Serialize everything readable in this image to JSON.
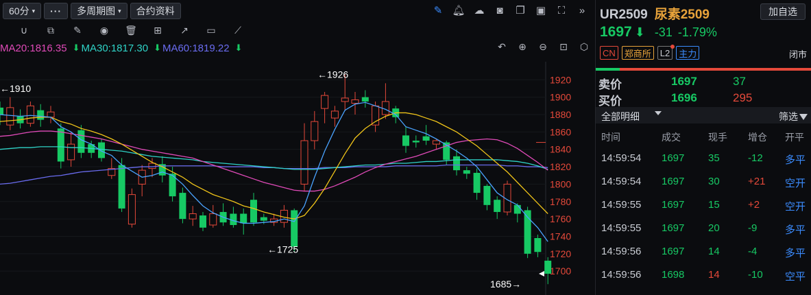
{
  "toolbar": {
    "period": "60分",
    "more": "···",
    "multi_period": "多周期图",
    "contract_info": "合约资料"
  },
  "ma": [
    {
      "label": "MA20:1816.35",
      "color": "#e04ab8",
      "arrow": ""
    },
    {
      "label": "MA30:1817.30",
      "color": "#2fd3c7",
      "arrow": "⬇"
    },
    {
      "label": "MA60:1819.22",
      "color": "#6a6cf0",
      "arrow": "⬇"
    }
  ],
  "ma_trailing_arrow": "⬇",
  "colors": {
    "up": "#e5493a",
    "down": "#17c964",
    "ma5": "#4aa3ff",
    "ma10": "#f0c419",
    "ma20": "#e04ab8",
    "ma30": "#2fd3c7",
    "ma60": "#6a6cf0",
    "accent": "#3b8cff"
  },
  "chart_data": {
    "type": "candlestick",
    "y_ticks": [
      1920,
      1900,
      1880,
      1860,
      1840,
      1820,
      1800,
      1780,
      1760,
      1740,
      1720,
      1700
    ],
    "ylim": [
      1682,
      1936
    ],
    "annotations": [
      {
        "text": "←1910",
        "value": 1910
      },
      {
        "text": "←1926",
        "value": 1926
      },
      {
        "text": "←1725",
        "value": 1725
      },
      {
        "text": "1685→",
        "value": 1685
      }
    ],
    "current_marker": 1697,
    "candles": [
      [
        1888,
        1880,
        1895,
        1868
      ],
      [
        1868,
        1888,
        1900,
        1862
      ],
      [
        1878,
        1870,
        1886,
        1864
      ],
      [
        1870,
        1890,
        1895,
        1866
      ],
      [
        1885,
        1874,
        1892,
        1866
      ],
      [
        1877,
        1883,
        1890,
        1870
      ],
      [
        1864,
        1826,
        1870,
        1818
      ],
      [
        1828,
        1846,
        1860,
        1820
      ],
      [
        1862,
        1836,
        1868,
        1830
      ],
      [
        1846,
        1836,
        1850,
        1830
      ],
      [
        1848,
        1830,
        1852,
        1826
      ],
      [
        1810,
        1818,
        1830,
        1806
      ],
      [
        1822,
        1772,
        1830,
        1768
      ],
      [
        1754,
        1788,
        1795,
        1750
      ],
      [
        1800,
        1816,
        1822,
        1786
      ],
      [
        1818,
        1824,
        1830,
        1808
      ],
      [
        1823,
        1810,
        1832,
        1802
      ],
      [
        1812,
        1786,
        1820,
        1780
      ],
      [
        1790,
        1760,
        1796,
        1755
      ],
      [
        1760,
        1766,
        1775,
        1752
      ],
      [
        1764,
        1750,
        1768,
        1746
      ],
      [
        1753,
        1766,
        1776,
        1750
      ],
      [
        1768,
        1756,
        1778,
        1752
      ],
      [
        1766,
        1753,
        1774,
        1750
      ],
      [
        1766,
        1755,
        1772,
        1742
      ],
      [
        1782,
        1756,
        1790,
        1752
      ],
      [
        1762,
        1758,
        1766,
        1754
      ],
      [
        1756,
        1760,
        1766,
        1752
      ],
      [
        1756,
        1770,
        1776,
        1750
      ],
      [
        1770,
        1728,
        1772,
        1722
      ],
      [
        1800,
        1850,
        1870,
        1792
      ],
      [
        1850,
        1872,
        1884,
        1840
      ],
      [
        1887,
        1902,
        1906,
        1870
      ],
      [
        1876,
        1884,
        1890,
        1866
      ],
      [
        1895,
        1899,
        1926,
        1884
      ],
      [
        1893,
        1897,
        1906,
        1880
      ],
      [
        1900,
        1895,
        1908,
        1888
      ],
      [
        1868,
        1890,
        1895,
        1860
      ],
      [
        1880,
        1895,
        1916,
        1875
      ],
      [
        1887,
        1877,
        1890,
        1870
      ],
      [
        1856,
        1844,
        1866,
        1836
      ],
      [
        1850,
        1848,
        1856,
        1842
      ],
      [
        1855,
        1850,
        1868,
        1845
      ],
      [
        1846,
        1850,
        1852,
        1840
      ],
      [
        1848,
        1828,
        1850,
        1822
      ],
      [
        1832,
        1816,
        1840,
        1810
      ],
      [
        1816,
        1812,
        1820,
        1806
      ],
      [
        1813,
        1790,
        1818,
        1782
      ],
      [
        1798,
        1776,
        1800,
        1770
      ],
      [
        1782,
        1768,
        1786,
        1760
      ],
      [
        1768,
        1800,
        1804,
        1764
      ],
      [
        1776,
        1766,
        1778,
        1756
      ],
      [
        1770,
        1720,
        1774,
        1715
      ],
      [
        1738,
        1722,
        1742,
        1716
      ],
      [
        1712,
        1697,
        1716,
        1685
      ]
    ],
    "ma5": [
      1880,
      1879,
      1878,
      1879,
      1878,
      1877,
      1866,
      1860,
      1851,
      1846,
      1838,
      1833,
      1822,
      1815,
      1808,
      1810,
      1814,
      1810,
      1800,
      1787,
      1775,
      1767,
      1762,
      1758,
      1755,
      1755,
      1756,
      1757,
      1760,
      1757,
      1775,
      1808,
      1838,
      1863,
      1885,
      1892,
      1894,
      1890,
      1886,
      1880,
      1866,
      1862,
      1858,
      1852,
      1845,
      1838,
      1830,
      1820,
      1805,
      1790,
      1782,
      1776,
      1762,
      1750,
      1734
    ],
    "ma10": [
      1872,
      1873,
      1874,
      1876,
      1877,
      1877,
      1872,
      1869,
      1864,
      1861,
      1857,
      1852,
      1846,
      1839,
      1832,
      1825,
      1820,
      1814,
      1808,
      1800,
      1794,
      1788,
      1784,
      1780,
      1775,
      1772,
      1768,
      1765,
      1762,
      1760,
      1764,
      1778,
      1795,
      1815,
      1835,
      1853,
      1864,
      1872,
      1878,
      1882,
      1882,
      1880,
      1876,
      1872,
      1866,
      1860,
      1852,
      1844,
      1834,
      1824,
      1814,
      1802,
      1790,
      1778,
      1766
    ],
    "ma20": [
      1855,
      1856,
      1858,
      1860,
      1861,
      1861,
      1860,
      1858,
      1856,
      1854,
      1852,
      1849,
      1846,
      1843,
      1840,
      1838,
      1836,
      1834,
      1832,
      1830,
      1826,
      1822,
      1818,
      1814,
      1810,
      1806,
      1802,
      1799,
      1796,
      1793,
      1792,
      1792,
      1794,
      1798,
      1803,
      1808,
      1814,
      1819,
      1823,
      1826,
      1829,
      1832,
      1836,
      1840,
      1844,
      1848,
      1850,
      1851,
      1852,
      1851,
      1847,
      1841,
      1833,
      1825,
      1816
    ],
    "ma30": [
      1840,
      1841,
      1842,
      1842,
      1843,
      1843,
      1843,
      1842,
      1842,
      1841,
      1840,
      1839,
      1838,
      1836,
      1834,
      1832,
      1831,
      1830,
      1829,
      1828,
      1826,
      1825,
      1824,
      1823,
      1822,
      1821,
      1820,
      1819,
      1818,
      1817,
      1817,
      1817,
      1818,
      1819,
      1820,
      1821,
      1822,
      1822,
      1823,
      1824,
      1824,
      1825,
      1826,
      1826,
      1827,
      1828,
      1828,
      1828,
      1828,
      1828,
      1827,
      1826,
      1824,
      1821,
      1817
    ],
    "ma60": [
      1800,
      1801,
      1803,
      1805,
      1807,
      1809,
      1810,
      1812,
      1814,
      1815,
      1816,
      1817,
      1818,
      1819,
      1820,
      1820,
      1821,
      1821,
      1821,
      1821,
      1821,
      1821,
      1820,
      1820,
      1820,
      1820,
      1819,
      1819,
      1818,
      1818,
      1818,
      1818,
      1819,
      1819,
      1819,
      1820,
      1820,
      1820,
      1820,
      1821,
      1821,
      1821,
      1821,
      1821,
      1822,
      1822,
      1822,
      1822,
      1822,
      1822,
      1821,
      1821,
      1820,
      1820,
      1819
    ]
  },
  "quote": {
    "code": "UR2509",
    "name": "尿素2509",
    "add_watch": "加自选",
    "price": "1697",
    "price_arrow": "⬇",
    "change": "-31",
    "change_pct": "-1.79%",
    "tags": [
      "CN",
      "郑商所",
      "L2",
      "主力"
    ],
    "status": "闭市",
    "buy_ratio": 0.11,
    "ask_label": "卖价",
    "ask_price": "1697",
    "ask_vol": "37",
    "bid_label": "买价",
    "bid_price": "1696",
    "bid_vol": "295"
  },
  "details": {
    "title": "全部明细",
    "filter": "筛选",
    "columns": [
      "时间",
      "成交",
      "现手",
      "增仓",
      "开平"
    ],
    "rows": [
      {
        "time": "14:59:54",
        "price": "1697",
        "vol": "35",
        "oi": "-12",
        "type": "多平",
        "vc": "g",
        "oc": "g",
        "tc": "b"
      },
      {
        "time": "14:59:54",
        "price": "1697",
        "vol": "30",
        "oi": "+21",
        "type": "空开",
        "vc": "g",
        "oc": "r",
        "tc": "b"
      },
      {
        "time": "14:59:55",
        "price": "1697",
        "vol": "15",
        "oi": "+2",
        "type": "空开",
        "vc": "g",
        "oc": "r",
        "tc": "b"
      },
      {
        "time": "14:59:55",
        "price": "1697",
        "vol": "20",
        "oi": "-9",
        "type": "多平",
        "vc": "g",
        "oc": "g",
        "tc": "b"
      },
      {
        "time": "14:59:56",
        "price": "1697",
        "vol": "14",
        "oi": "-4",
        "type": "多平",
        "vc": "g",
        "oc": "g",
        "tc": "b"
      },
      {
        "time": "14:59:56",
        "price": "1698",
        "vol": "14",
        "oi": "-10",
        "type": "空平",
        "vc": "r",
        "oc": "g",
        "tc": "b"
      }
    ]
  }
}
